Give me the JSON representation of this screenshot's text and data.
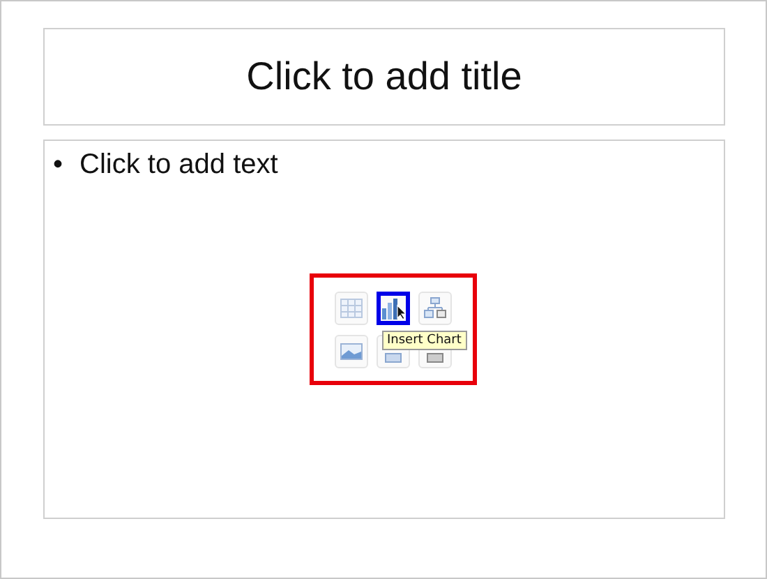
{
  "title_placeholder": {
    "text": "Click to add title"
  },
  "content_placeholder": {
    "bullet": "•",
    "text": "Click to add text",
    "icons": [
      {
        "kind": "table",
        "selected": false
      },
      {
        "kind": "chart",
        "selected": true
      },
      {
        "kind": "smartart",
        "selected": false
      },
      {
        "kind": "picture",
        "selected": false
      },
      {
        "kind": "clipart",
        "selected": false
      },
      {
        "kind": "media",
        "selected": false
      }
    ],
    "tooltip": "Insert Chart"
  }
}
